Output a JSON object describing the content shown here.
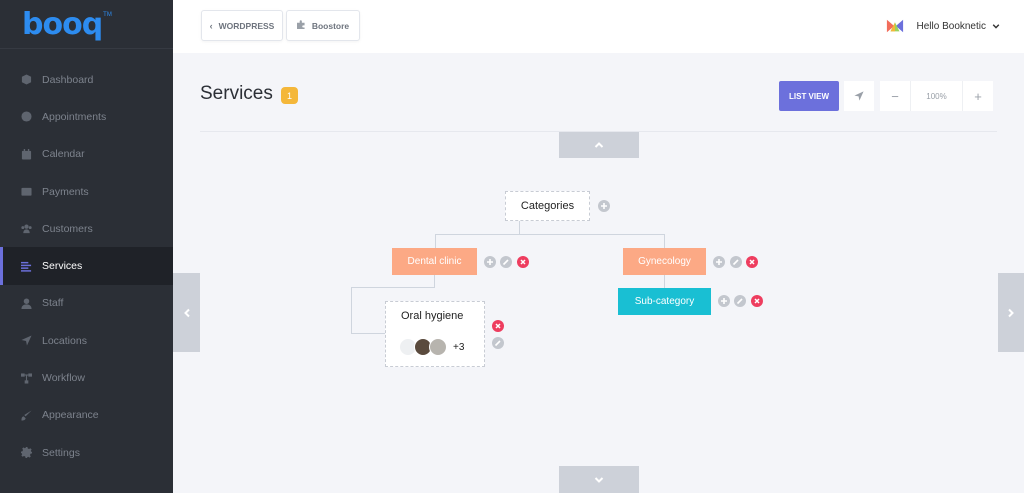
{
  "brand": {
    "logo_text": "booq",
    "logo_tm": "TM"
  },
  "sidebar": {
    "items": [
      {
        "label": "Dashboard",
        "icon": "cube-icon",
        "active": false
      },
      {
        "label": "Appointments",
        "icon": "clock-icon",
        "active": false
      },
      {
        "label": "Calendar",
        "icon": "calendar-icon",
        "active": false
      },
      {
        "label": "Payments",
        "icon": "wallet-icon",
        "active": false
      },
      {
        "label": "Customers",
        "icon": "users-icon",
        "active": false
      },
      {
        "label": "Services",
        "icon": "list-icon",
        "active": true
      },
      {
        "label": "Staff",
        "icon": "user-icon",
        "active": false
      },
      {
        "label": "Locations",
        "icon": "location-arrow-icon",
        "active": false
      },
      {
        "label": "Workflow",
        "icon": "workflow-icon",
        "active": false
      },
      {
        "label": "Appearance",
        "icon": "brush-icon",
        "active": false
      },
      {
        "label": "Settings",
        "icon": "gear-icon",
        "active": false
      }
    ]
  },
  "topbar": {
    "wordpress_label": "WORDPRESS",
    "boostore_label": "Boostore",
    "user_greeting": "Hello Booknetic"
  },
  "header": {
    "title": "Services",
    "count": "1",
    "list_view_label": "LIST VIEW",
    "zoom_value": "100%",
    "zoom_minus": "−",
    "zoom_plus": "+"
  },
  "tree": {
    "root_label": "Categories",
    "categories": [
      {
        "label": "Dental clinic",
        "color": "#fca985"
      },
      {
        "label": "Gynecology",
        "color": "#fca985"
      }
    ],
    "subcategories": [
      {
        "label": "Sub-category",
        "parent": "Gynecology",
        "color": "#19bfd3"
      }
    ],
    "services": [
      {
        "name": "Oral hygiene",
        "parent": "Dental clinic",
        "extra_staff": "+3"
      }
    ]
  },
  "colors": {
    "accent": "#6c70dc",
    "badge": "#f4b73a",
    "category": "#fca985",
    "subcategory": "#19bfd3",
    "danger": "#ee3d5f"
  }
}
